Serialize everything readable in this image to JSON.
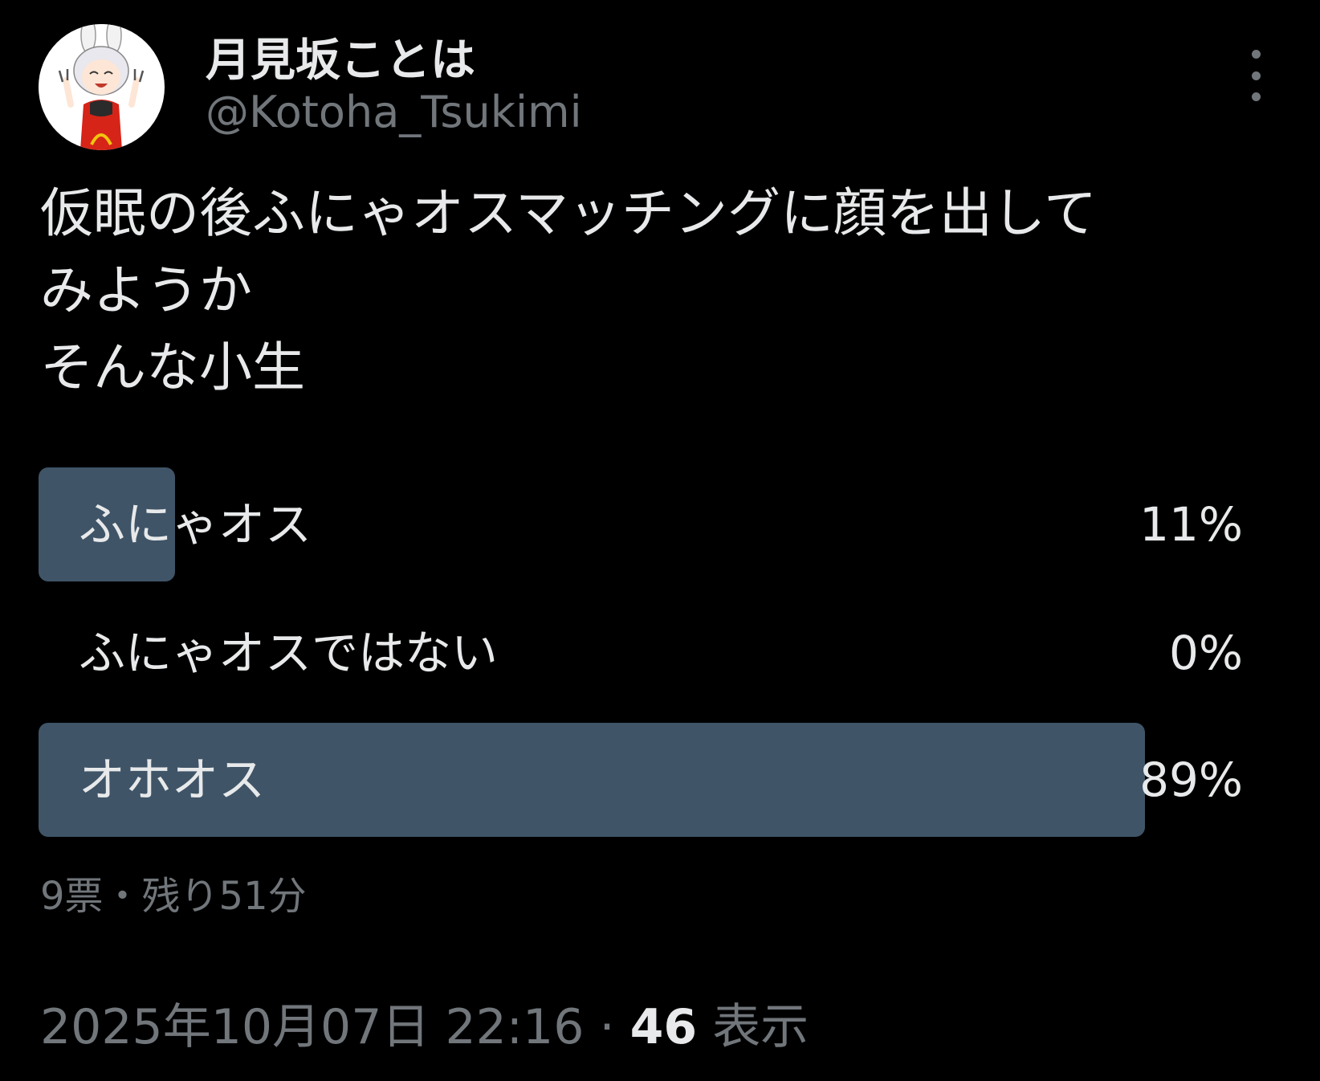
{
  "author": {
    "name": "月見坂ことは",
    "handle": "@Kotoha_Tsukimi"
  },
  "tweet": {
    "text_lines": [
      "仮眠の後ふにゃオスマッチングに顔を出して",
      "みようか",
      "そんな小生"
    ]
  },
  "poll": {
    "options": [
      {
        "label": "ふにゃオス",
        "percent_label": "11%",
        "percent": 11
      },
      {
        "label": "ふにゃオスではない",
        "percent_label": "0%",
        "percent": 0
      },
      {
        "label": "オホオス",
        "percent_label": "89%",
        "percent": 89
      }
    ],
    "meta": "9票・残り51分",
    "bar_color": "#3f5467"
  },
  "footer": {
    "datetime": "2025年10月07日 22:16",
    "separator": "·",
    "views_count": "46",
    "views_label": "表示"
  },
  "icons": {
    "more": "more-vertical-icon",
    "avatar": "avatar-image"
  }
}
